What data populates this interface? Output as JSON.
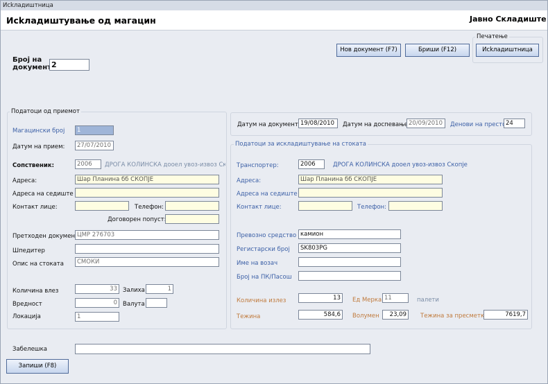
{
  "window": {
    "title": "Исkладиштница"
  },
  "header": {
    "title": "Исkладиштување од магацин",
    "company": "Јавно Складиште"
  },
  "toolbar": {
    "print_group_label": "Печатење",
    "new_doc_label": "Нов документ (F7)",
    "delete_label": "Бриши (F12)",
    "issue_label": "Исkладиштница"
  },
  "doc": {
    "label": "Број на документ",
    "value": "2"
  },
  "reception": {
    "group_label": "Податоци од приемот",
    "warehouse_no_label": "Магацински број",
    "warehouse_no_value": "1",
    "date_label": "Датум на прием:",
    "date_value": "27/07/2010",
    "owner_label": "Сопственик:",
    "owner_code": "2006",
    "owner_name": "ДРОГА КОЛИНСКА дооел увоз-извоз Скоп",
    "address_label": "Адреса:",
    "address_value": "Шар Планина бб СКОПЈЕ",
    "hq_label": "Адреса на седиште :",
    "contact_label": "Контакт лице:",
    "phone_label": "Телефон:",
    "discount_label": "Договорен попуст:",
    "prev_doc_label": "Претходен документ",
    "prev_doc_value": "ЦМР 276703",
    "forwarder_label": "Шпедитер",
    "goods_label": "Опис на стоката",
    "goods_value": "СМОКИ",
    "qty_in_label": "Количина влез",
    "qty_in_value": "33",
    "stock_label": "Залиха",
    "stock_value": "1",
    "value_label": "Вредност",
    "value_value": "0",
    "currency_label": "Валута",
    "location_label": "Локација",
    "location_value": "1"
  },
  "dates": {
    "doc_date_label": "Датум на документ:",
    "doc_date_value": "19/08/2010",
    "due_label": "Датум на доспевање:",
    "due_value": "20/09/2010",
    "storage_days_label": "Денови на престој",
    "storage_days_value": "24"
  },
  "issue": {
    "group_label": "Податоци за искладиштување на стоката",
    "carrier_label": "Транспортер:",
    "carrier_code": "2006",
    "carrier_name": "ДРОГА КОЛИНСКА дооел увоз-извоз Скопје",
    "address_label": "Адреса:",
    "address_value": "Шар Планина бб СКОПЈЕ",
    "hq_label": "Адреса на седиште :",
    "contact_label": "Контакт лице:",
    "phone_label": "Телефон:",
    "vehicle_label": "Превозно средство",
    "vehicle_value": "камион",
    "plate_label": "Регистарски број",
    "plate_value": "SK803PG",
    "driver_label": "Име на возач",
    "passport_label": "Број на ПК/Пасош",
    "qty_out_label": "Количина излез",
    "qty_out_value": "13",
    "unit_label": "Ед Мерка",
    "unit_value": "11",
    "unit_name": "палети",
    "weight_label": "Тежина",
    "weight_value": "584,6",
    "volume_label": "Волумен",
    "volume_value": "23,09",
    "calc_weight_label": "Тежина за пресметка",
    "calc_weight_value": "7619,7"
  },
  "footer": {
    "note_label": "Забелешка",
    "save_label": "Запиши (F8)"
  },
  "colors": {
    "field_yellow": "#fefde2",
    "label_blue": "#3b5fa6",
    "label_orange": "#c07a3c",
    "button_border": "#4f6a99"
  }
}
